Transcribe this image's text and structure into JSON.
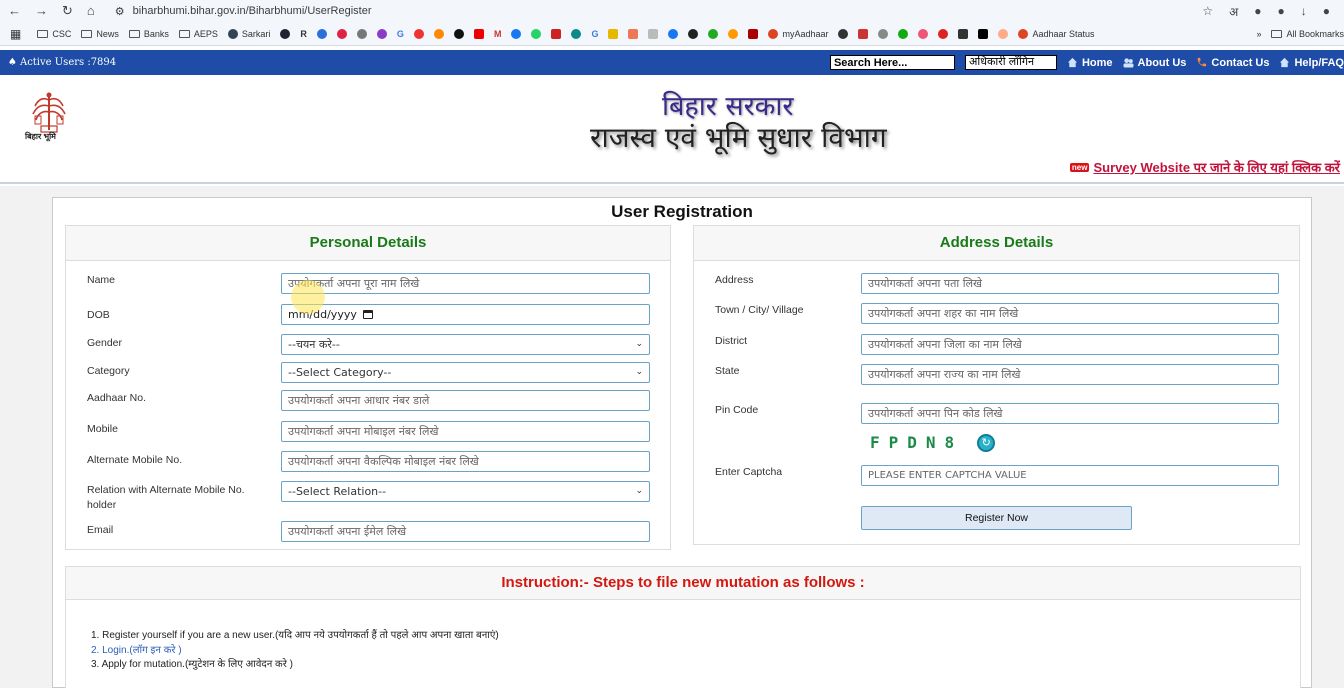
{
  "browser": {
    "url": "biharbhumi.bihar.gov.in/Biharbhumi/UserRegister",
    "bookmarks": [
      "CSC",
      "News",
      "Banks",
      "AEPS",
      "Sarkari",
      "R",
      "G",
      "G",
      "M",
      "myAadhaar",
      "Aadhaar Status"
    ],
    "all_bookmarks": "All Bookmarks",
    "toolbar_letter": "अ"
  },
  "sitebar": {
    "active_users": "Active Users :7894",
    "search_placeholder": "Search Here...",
    "officer_login": "अधिकारी लॉगिन",
    "home": "Home",
    "about": "About Us",
    "contact": "Contact Us",
    "help": "Help/FAQ"
  },
  "header": {
    "logo_caption": "बिहार भूमि",
    "title1": "बिहार सरकार",
    "title2": "राजस्व एवं भूमि सुधार विभाग",
    "survey_link": "Survey Website पर जाने के लिए यहां क्लिक करें",
    "new_badge": "new"
  },
  "form": {
    "title": "User Registration",
    "personal": {
      "heading": "Personal Details",
      "name_label": "Name",
      "name_placeholder": "उपयोगकर्ता अपना पूरा नाम लिखे",
      "dob_label": "DOB",
      "dob_value": "mm/dd/yyyy",
      "gender_label": "Gender",
      "gender_value": "--चयन करे--",
      "category_label": "Category",
      "category_value": "--Select Category--",
      "aadhaar_label": "Aadhaar No.",
      "aadhaar_placeholder": "उपयोगकर्ता अपना आधार नंबर डाले",
      "mobile_label": "Mobile",
      "mobile_placeholder": "उपयोगकर्ता अपना मोबाइल नंबर लिखे",
      "alt_mobile_label": "Alternate Mobile No.",
      "alt_mobile_placeholder": "उपयोगकर्ता अपना वैकल्पिक मोबाइल नंबर लिखे",
      "relation_label_1": "Relation with Alternate Mobile No.",
      "relation_label_2": "holder",
      "relation_value": "--Select Relation--",
      "email_label": "Email",
      "email_placeholder": "उपयोगकर्ता अपना ईमेल लिखे"
    },
    "address": {
      "heading": "Address Details",
      "address_label": "Address",
      "address_placeholder": "उपयोगकर्ता अपना पता लिखे",
      "town_label": "Town / City/ Village",
      "town_placeholder": "उपयोगकर्ता अपना शहर का नाम लिखे",
      "district_label": "District",
      "district_placeholder": "उपयोगकर्ता अपना जिला का नाम लिखे",
      "state_label": "State",
      "state_placeholder": "उपयोगकर्ता अपना राज्य का नाम लिखे",
      "pin_label": "Pin Code",
      "pin_placeholder": "उपयोगकर्ता अपना पिन कोड लिखे",
      "captcha_text": "FPDN8",
      "captcha_label": "Enter Captcha",
      "captcha_placeholder": "PLEASE ENTER CAPTCHA VALUE",
      "register_button": "Register Now"
    }
  },
  "instructions": {
    "heading": "Instruction:- Steps to file new mutation as follows :",
    "step1": "1. Register yourself if you are a new user.(यदि आप नये उपयोगकर्ता हैं तो पहले आप अपना खाता बनाएं)",
    "step2": "2. Login.(लॉग इन करे )",
    "step3": "3. Apply for mutation.(म्युटेशन के लिए आवेदन करे )"
  }
}
